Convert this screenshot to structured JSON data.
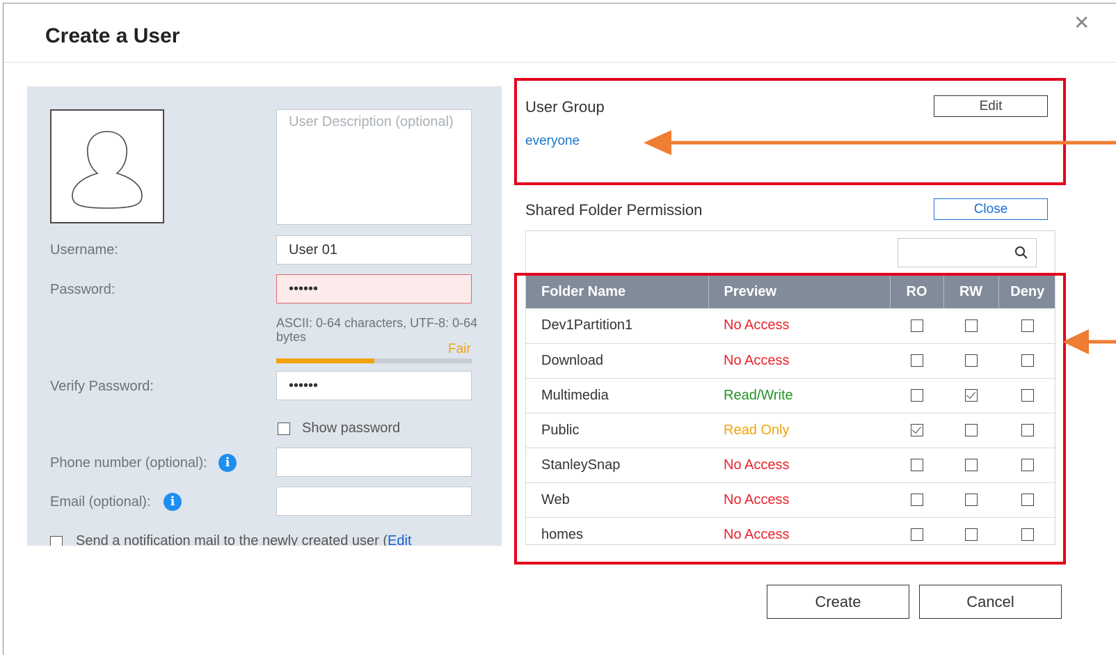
{
  "dialog": {
    "title": "Create a User"
  },
  "user_form": {
    "description_placeholder": "User Description (optional)",
    "username_label": "Username:",
    "username_value": "User 01",
    "password_label": "Password:",
    "password_value": "••••••",
    "password_hint": "ASCII: 0-64 characters, UTF-8: 0-64 bytes",
    "strength_label": "Fair",
    "strength_fraction": 0.5,
    "verify_label": "Verify Password:",
    "verify_value": "••••••",
    "show_password_label": "Show password",
    "phone_label": "Phone number (optional):",
    "email_label": "Email (optional):",
    "notify_label": "Send a notification mail to the newly created user (",
    "notify_edit": "Edit"
  },
  "user_group": {
    "title": "User Group",
    "edit_label": "Edit",
    "group": "everyone"
  },
  "shared_folder": {
    "title": "Shared Folder Permission",
    "close_label": "Close",
    "columns": [
      "Folder Name",
      "Preview",
      "RO",
      "RW",
      "Deny"
    ],
    "rows": [
      {
        "name": "Dev1Partition1",
        "preview": "No Access",
        "ro": false,
        "rw": false,
        "deny": false
      },
      {
        "name": "Download",
        "preview": "No Access",
        "ro": false,
        "rw": false,
        "deny": false
      },
      {
        "name": "Multimedia",
        "preview": "Read/Write",
        "ro": false,
        "rw": true,
        "deny": false
      },
      {
        "name": "Public",
        "preview": "Read Only",
        "ro": true,
        "rw": false,
        "deny": false
      },
      {
        "name": "StanleySnap",
        "preview": "No Access",
        "ro": false,
        "rw": false,
        "deny": false
      },
      {
        "name": "Web",
        "preview": "No Access",
        "ro": false,
        "rw": false,
        "deny": false
      },
      {
        "name": "homes",
        "preview": "No Access",
        "ro": false,
        "rw": false,
        "deny": false
      }
    ]
  },
  "actions": {
    "create_label": "Create",
    "cancel_label": "Cancel"
  },
  "colors": {
    "annotation_box": "#e3001b",
    "annotation_arrow": "#ef7d32",
    "accent": "#1a6ed8"
  },
  "icons": {
    "close": "close-icon",
    "avatar": "user-avatar-icon",
    "info": "info-icon",
    "search": "search-icon",
    "arrow": "arrow-left-icon"
  }
}
